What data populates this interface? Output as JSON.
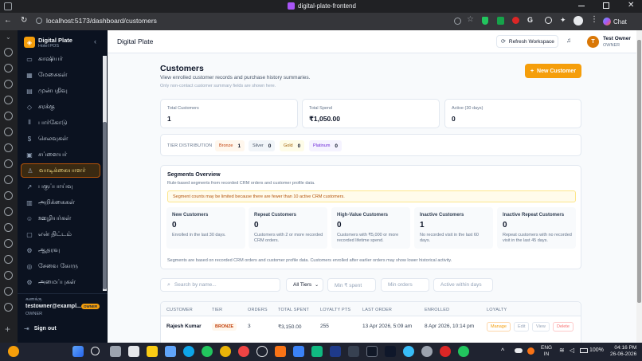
{
  "browser": {
    "tab_title": "digital-plate-frontend",
    "url": "localhost:5173/dashboard/customers",
    "chat_label": "Chat"
  },
  "sidebar": {
    "brand": "Digital Plate",
    "subbrand": "Hotel POS",
    "items": [
      {
        "label": "காஷியர்",
        "icon": "cash-icon"
      },
      {
        "label": "மேசைகள்",
        "icon": "tables-icon"
      },
      {
        "label": "முன்பதிவு",
        "icon": "reservation-icon"
      },
      {
        "label": "சரக்கு",
        "icon": "inventory-icon"
      },
      {
        "label": "பார்கோடு",
        "icon": "barcode-icon"
      },
      {
        "label": "செலவுகள்",
        "icon": "expenses-icon"
      },
      {
        "label": "சப்ளையர்",
        "icon": "supplier-icon"
      },
      {
        "label": "வாடிக்கையாளர்",
        "icon": "customer-icon"
      },
      {
        "label": "பகுப்பாய்வு",
        "icon": "analytics-icon"
      },
      {
        "label": "அறிக்கைகள்",
        "icon": "reports-icon"
      },
      {
        "label": "ஊழியர்கள்",
        "icon": "staff-icon"
      },
      {
        "label": "என் திட்டம்",
        "icon": "plan-icon"
      },
      {
        "label": "ஆதரவு",
        "icon": "support-icon"
      },
      {
        "label": "சேவை கோரு",
        "icon": "service-icon"
      },
      {
        "label": "அமைப்புகள்",
        "icon": "settings-icon"
      }
    ],
    "active_index": 7,
    "account_label": "கணக்கு",
    "account_email": "testowner@exampl...",
    "account_badge": "OWNER",
    "account_role": "OWNER",
    "signout": "Sign out"
  },
  "header": {
    "title": "Digital Plate",
    "refresh": "Refresh Workspace",
    "user_initial": "T",
    "user_name": "Test Owner",
    "user_role": "OWNER"
  },
  "page": {
    "title": "Customers",
    "subtitle": "View enrolled customer records and purchase history summaries.",
    "note": "Only non-contact customer summary fields are shown here.",
    "new_button": "New Customer"
  },
  "stats": [
    {
      "label": "Total Customers",
      "value": "1"
    },
    {
      "label": "Total Spend",
      "value": "₹1,050.00"
    },
    {
      "label": "Active (30 days)",
      "value": "0"
    }
  ],
  "tiers": {
    "label": "TIER DISTRIBUTION",
    "items": [
      {
        "name": "Bronze",
        "count": "1"
      },
      {
        "name": "Silver",
        "count": "0"
      },
      {
        "name": "Gold",
        "count": "0"
      },
      {
        "name": "Platinum",
        "count": "0"
      }
    ]
  },
  "segments": {
    "title": "Segments Overview",
    "subtitle": "Rule-based segments from recorded CRM orders and customer profile data.",
    "warning": "Segment counts may be limited because there are fewer than 10 active CRM customers.",
    "cards": [
      {
        "title": "New Customers",
        "value": "0",
        "desc": "Enrolled in the last 30 days."
      },
      {
        "title": "Repeat Customers",
        "value": "0",
        "desc": "Customers with 2 or more recorded CRM orders."
      },
      {
        "title": "High-Value Customers",
        "value": "0",
        "desc": "Customers with ₹5,000 or more recorded lifetime spend."
      },
      {
        "title": "Inactive Customers",
        "value": "1",
        "desc": "No recorded visit in the last 60 days."
      },
      {
        "title": "Inactive Repeat Customers",
        "value": "0",
        "desc": "Repeat customers with no recorded visit in the last 45 days."
      }
    ],
    "footnote": "Segments are based on recorded CRM orders and customer profile data. Customers enrolled after earlier orders may show lower historical activity."
  },
  "filters": {
    "search_placeholder": "Search by name...",
    "tier_select": "All Tiers",
    "min_spent": "Min ₹ spent",
    "min_orders": "Min orders",
    "active_within": "Active within days"
  },
  "table": {
    "headers": [
      "CUSTOMER",
      "TIER",
      "ORDERS",
      "TOTAL SPENT",
      "LOYALTY PTS",
      "LAST ORDER",
      "ENROLLED",
      "LOYALTY"
    ],
    "rows": [
      {
        "customer": "Rajesh Kumar",
        "tier": "BRONZE",
        "orders": "3",
        "spent": "₹3,150.00",
        "points": "255",
        "last_order": "13 Apr 2026, 5:09 am",
        "enrolled": "8 Apr 2026, 10:14 pm",
        "actions": [
          "Manage",
          "Edit",
          "View",
          "Delete"
        ]
      }
    ]
  },
  "taskbar": {
    "lang_top": "ENG",
    "lang_bottom": "IN",
    "battery": "100%",
    "time": "04:16 PM",
    "date": "26-06-2026"
  }
}
